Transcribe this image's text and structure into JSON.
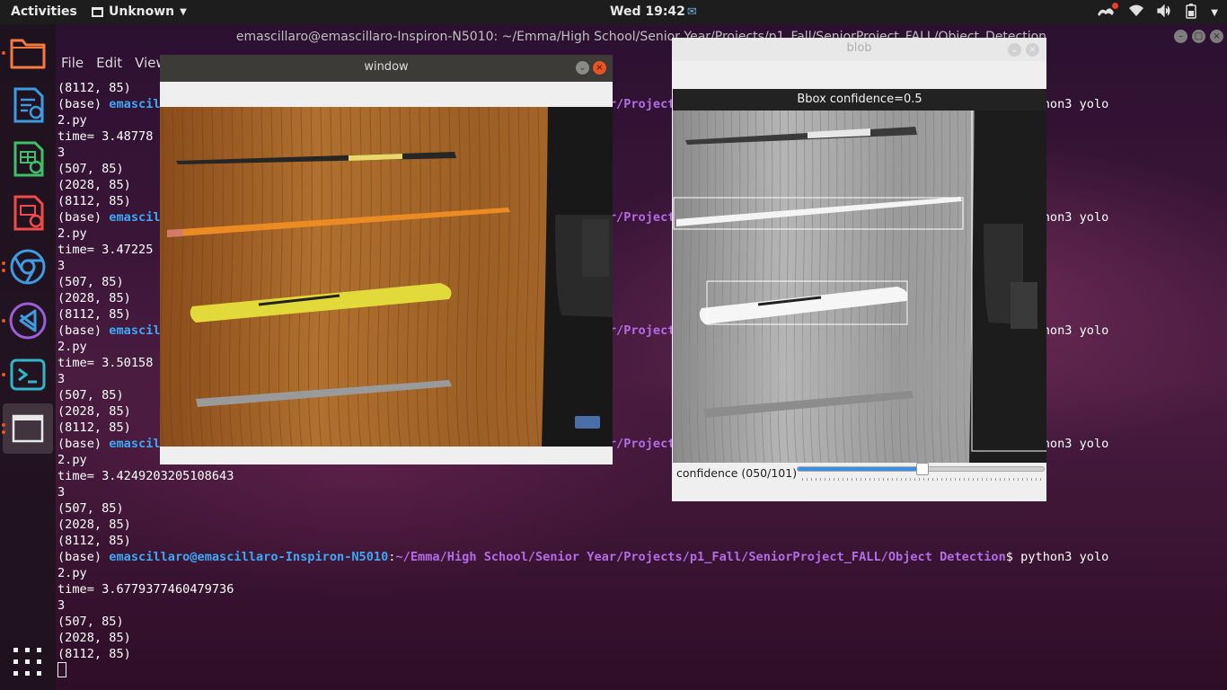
{
  "topbar": {
    "activities": "Activities",
    "app_name": "Unknown",
    "clock": "Wed 19:42",
    "tray_icons": [
      "update-notifier-icon",
      "wifi-icon",
      "volume-icon",
      "battery-icon",
      "power-menu-icon"
    ]
  },
  "dock": {
    "items": [
      "files",
      "libreoffice-writer",
      "libreoffice-calc",
      "libreoffice-impress",
      "chrome",
      "vscode",
      "terminal",
      "generic-window"
    ],
    "show_apps_icon": "show-applications-icon"
  },
  "terminal": {
    "title": "emascillaro@emascillaro-Inspiron-N5010: ~/Emma/High School/Senior Year/Projects/p1_Fall/SeniorProject_FALL/Object_Detection",
    "menu": [
      "File",
      "Edit",
      "View"
    ],
    "prompt_base": "(base) ",
    "prompt_user": "emascillaro@emascillaro-Inspiron-N5010",
    "prompt_colon": ":",
    "prompt_path": "~/Emma/High School/Senior Year/Projects/p1_Fall/SeniorProject_FALL/Object Detection",
    "prompt_cmd": "$ python3 yolo",
    "lines": [
      {
        "type": "out",
        "text": "(8112, 85)"
      },
      {
        "type": "prompt"
      },
      {
        "type": "out",
        "text": "2.py"
      },
      {
        "type": "out",
        "text": "time= 3.48778"
      },
      {
        "type": "out",
        "text": "3"
      },
      {
        "type": "out",
        "text": "(507, 85)"
      },
      {
        "type": "out",
        "text": "(2028, 85)"
      },
      {
        "type": "out",
        "text": "(8112, 85)"
      },
      {
        "type": "prompt"
      },
      {
        "type": "out",
        "text": "2.py"
      },
      {
        "type": "out",
        "text": "time= 3.47225"
      },
      {
        "type": "out",
        "text": "3"
      },
      {
        "type": "out",
        "text": "(507, 85)"
      },
      {
        "type": "out",
        "text": "(2028, 85)"
      },
      {
        "type": "out",
        "text": "(8112, 85)"
      },
      {
        "type": "prompt"
      },
      {
        "type": "out",
        "text": "2.py"
      },
      {
        "type": "out",
        "text": "time= 3.50158"
      },
      {
        "type": "out",
        "text": "3"
      },
      {
        "type": "out",
        "text": "(507, 85)"
      },
      {
        "type": "out",
        "text": "(2028, 85)"
      },
      {
        "type": "out",
        "text": "(8112, 85)"
      },
      {
        "type": "prompt"
      },
      {
        "type": "out",
        "text": "2.py"
      },
      {
        "type": "out",
        "text": "time= 3.4249203205108643"
      },
      {
        "type": "out",
        "text": "3"
      },
      {
        "type": "out",
        "text": "(507, 85)"
      },
      {
        "type": "out",
        "text": "(2028, 85)"
      },
      {
        "type": "out",
        "text": "(8112, 85)"
      },
      {
        "type": "prompt"
      },
      {
        "type": "out",
        "text": "2.py"
      },
      {
        "type": "out",
        "text": "time= 3.6779377460479736"
      },
      {
        "type": "out",
        "text": "3"
      },
      {
        "type": "out",
        "text": "(507, 85)"
      },
      {
        "type": "out",
        "text": "(2028, 85)"
      },
      {
        "type": "out",
        "text": "(8112, 85)"
      },
      {
        "type": "cursor"
      }
    ]
  },
  "window1": {
    "title": "window",
    "image": "color photo of pens and pencils on a wooden desk"
  },
  "window2": {
    "title": "blob",
    "image_caption": "Bbox confidence=0.5",
    "slider_label": "confidence (050/101)",
    "slider_value": 50,
    "slider_max": 101
  }
}
